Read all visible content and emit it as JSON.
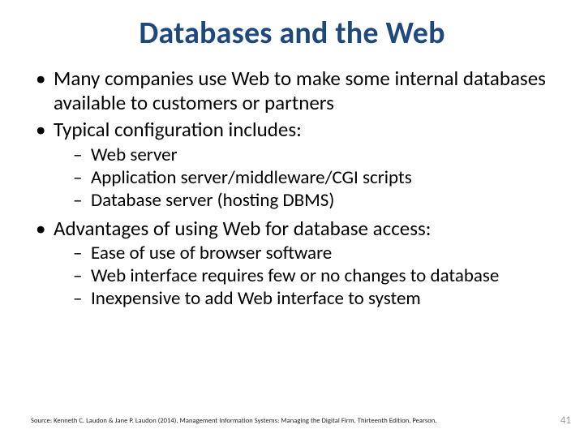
{
  "title": "Databases and the Web",
  "bullets": {
    "b0": "Many companies use Web to make some internal databases available to customers or partners",
    "b1": "Typical configuration includes:",
    "b1_sub": {
      "s0": "Web server",
      "s1": "Application server/middleware/CGI scripts",
      "s2": "Database server (hosting DBMS)"
    },
    "b2": "Advantages of using Web for database access:",
    "b2_sub": {
      "s0": "Ease of use of browser software",
      "s1": "Web interface requires few or no changes to database",
      "s2": "Inexpensive to add Web interface to system"
    }
  },
  "source": "Source: Kenneth C. Laudon & Jane P. Laudon (2014), Management Information Systems: Managing the Digital Firm, Thirteenth Edition, Pearson.",
  "page": "41"
}
